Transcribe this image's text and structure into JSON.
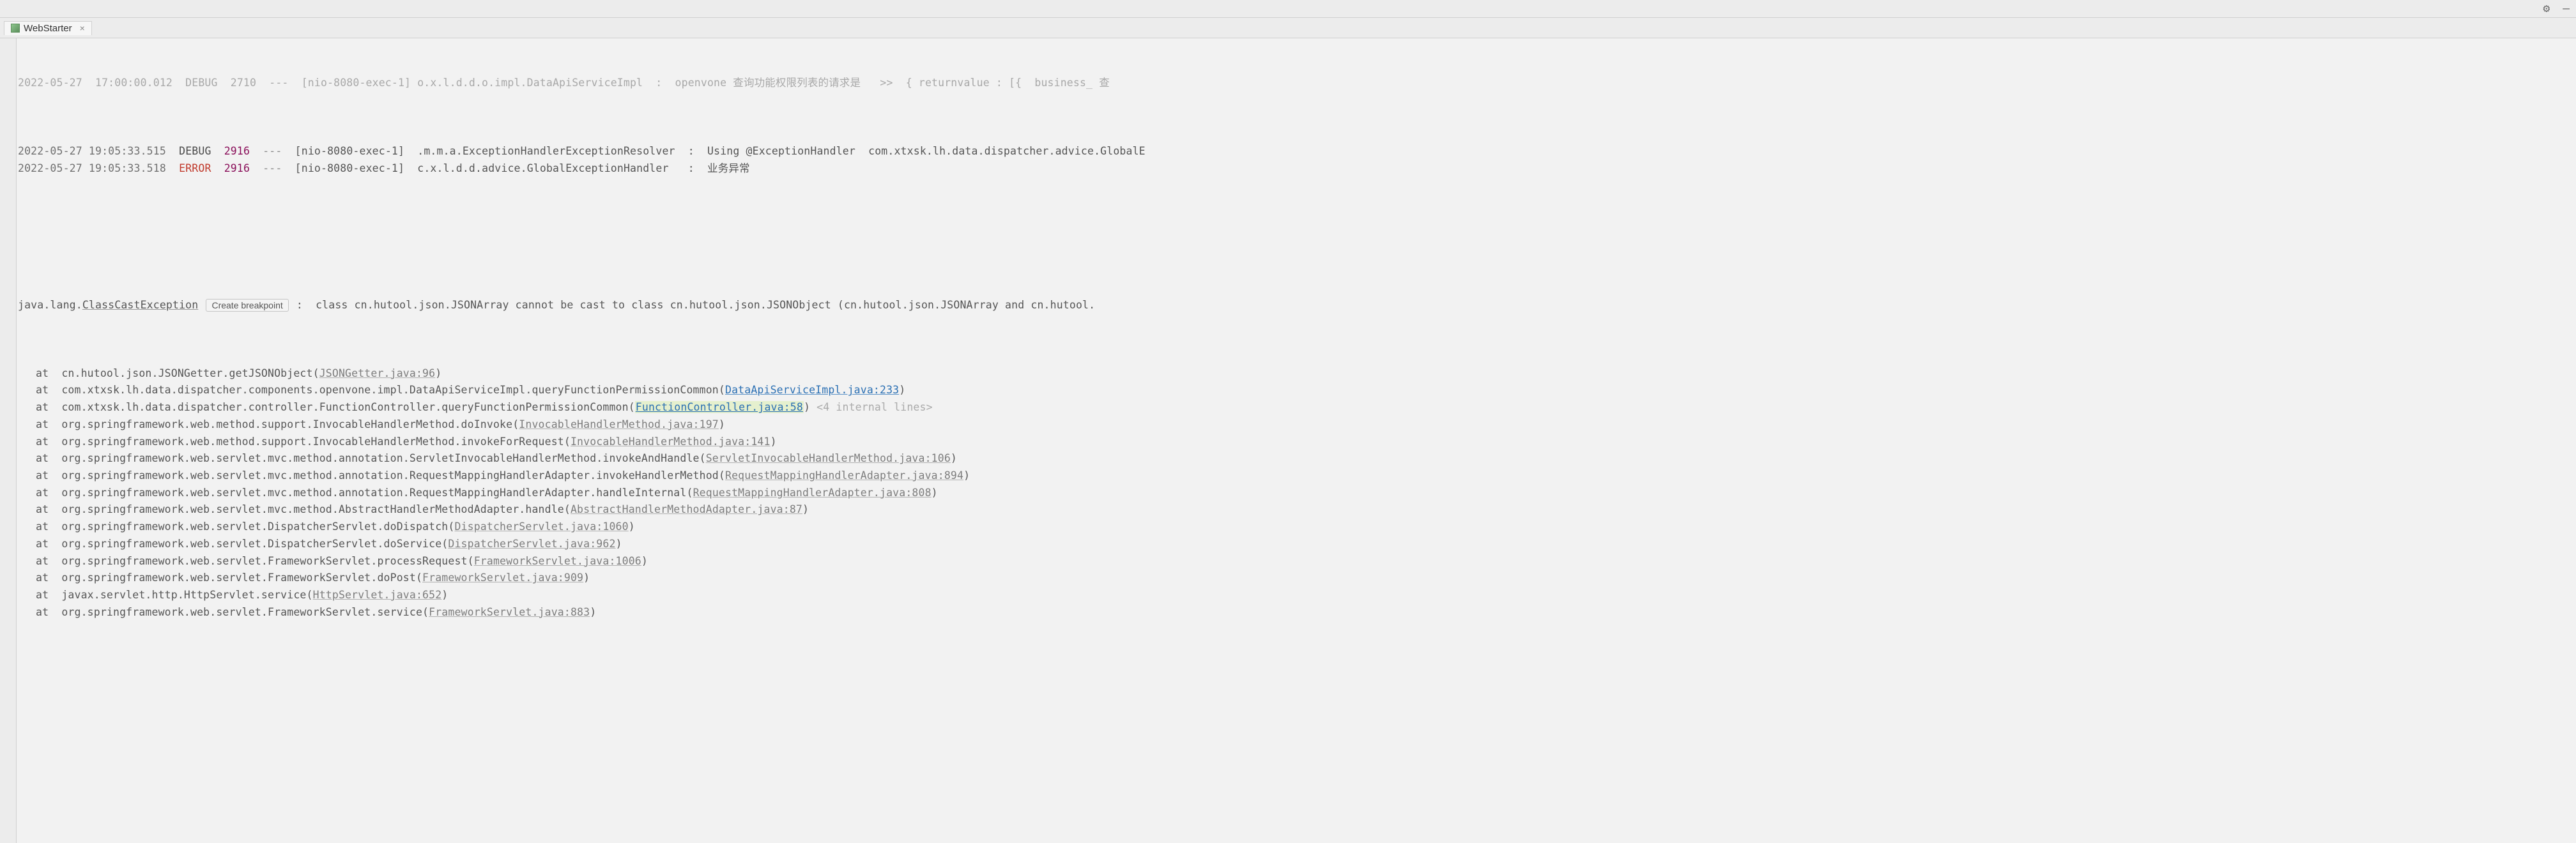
{
  "tab": {
    "title": "WebStarter",
    "close_glyph": "×"
  },
  "top": {
    "gear_glyph": "⚙",
    "minus_glyph": "—"
  },
  "log_partial": {
    "prefix": "2022-05-27  17:00:00.012  DEBUG  2710  ---  [nio-8080-exec-1] o.x.l.d.d.o.impl.DataApiServiceImpl  :  openvone 查询功能权限列表的请求是   >>  { returnvalue : [{  business_ 查"
  },
  "logs": [
    {
      "ts": "2022-05-27 19:05:33.515",
      "level": "DEBUG",
      "pid": "2916",
      "thread": "[nio-8080-exec-1]",
      "logger": ".m.m.a.ExceptionHandlerExceptionResolver",
      "msg": "Using @ExceptionHandler  com.xtxsk.lh.data.dispatcher.advice.GlobalE"
    },
    {
      "ts": "2022-05-27 19:05:33.518",
      "level": "ERROR",
      "pid": "2916",
      "thread": "[nio-8080-exec-1]",
      "logger": "c.x.l.d.d.advice.GlobalExceptionHandler ",
      "msg_cn": "业务异常"
    }
  ],
  "exception": {
    "class": "java.lang.",
    "name": "ClassCastException",
    "breakpoint_label": "Create breakpoint",
    "msg": " :  class cn.hutool.json.JSONArray cannot be cast to class cn.hutool.json.JSONObject (cn.hutool.json.JSONArray and cn.hutool."
  },
  "collapsed": "<4 internal lines>",
  "stack": [
    {
      "pre": "at  cn.hutool.json.JSONGetter.getJSONObject(",
      "link": "JSONGetter.java:96",
      "cls": "src-link",
      "post": ")"
    },
    {
      "pre": "at  com.xtxsk.lh.data.dispatcher.components.openvone.impl.DataApiServiceImpl.queryFunctionPermissionCommon(",
      "link": "DataApiServiceImpl.java:233",
      "cls": "src-link-blue",
      "post": ")"
    },
    {
      "pre": "at  com.xtxsk.lh.data.dispatcher.controller.FunctionController.queryFunctionPermissionCommon(",
      "link": "FunctionController.java:58",
      "cls": "src-link-hot",
      "post": ") ",
      "collapsed": true
    },
    {
      "pre": "at  org.springframework.web.method.support.InvocableHandlerMethod.doInvoke(",
      "link": "InvocableHandlerMethod.java:197",
      "cls": "src-link",
      "post": ")"
    },
    {
      "pre": "at  org.springframework.web.method.support.InvocableHandlerMethod.invokeForRequest(",
      "link": "InvocableHandlerMethod.java:141",
      "cls": "src-link",
      "post": ")"
    },
    {
      "pre": "at  org.springframework.web.servlet.mvc.method.annotation.ServletInvocableHandlerMethod.invokeAndHandle(",
      "link": "ServletInvocableHandlerMethod.java:106",
      "cls": "src-link",
      "post": ")"
    },
    {
      "pre": "at  org.springframework.web.servlet.mvc.method.annotation.RequestMappingHandlerAdapter.invokeHandlerMethod(",
      "link": "RequestMappingHandlerAdapter.java:894",
      "cls": "src-link",
      "post": ")"
    },
    {
      "pre": "at  org.springframework.web.servlet.mvc.method.annotation.RequestMappingHandlerAdapter.handleInternal(",
      "link": "RequestMappingHandlerAdapter.java:808",
      "cls": "src-link",
      "post": ")"
    },
    {
      "pre": "at  org.springframework.web.servlet.mvc.method.AbstractHandlerMethodAdapter.handle(",
      "link": "AbstractHandlerMethodAdapter.java:87",
      "cls": "src-link",
      "post": ")"
    },
    {
      "pre": "at  org.springframework.web.servlet.DispatcherServlet.doDispatch(",
      "link": "DispatcherServlet.java:1060",
      "cls": "src-link",
      "post": ")"
    },
    {
      "pre": "at  org.springframework.web.servlet.DispatcherServlet.doService(",
      "link": "DispatcherServlet.java:962",
      "cls": "src-link",
      "post": ")"
    },
    {
      "pre": "at  org.springframework.web.servlet.FrameworkServlet.processRequest(",
      "link": "FrameworkServlet.java:1006",
      "cls": "src-link",
      "post": ")"
    },
    {
      "pre": "at  org.springframework.web.servlet.FrameworkServlet.doPost(",
      "link": "FrameworkServlet.java:909",
      "cls": "src-link",
      "post": ")"
    },
    {
      "pre": "at  javax.servlet.http.HttpServlet.service(",
      "link": "HttpServlet.java:652",
      "cls": "src-link",
      "post": ")"
    },
    {
      "pre": "at  org.springframework.web.servlet.FrameworkServlet.service(",
      "link": "FrameworkServlet.java:883",
      "cls": "src-link",
      "post": ")"
    }
  ]
}
